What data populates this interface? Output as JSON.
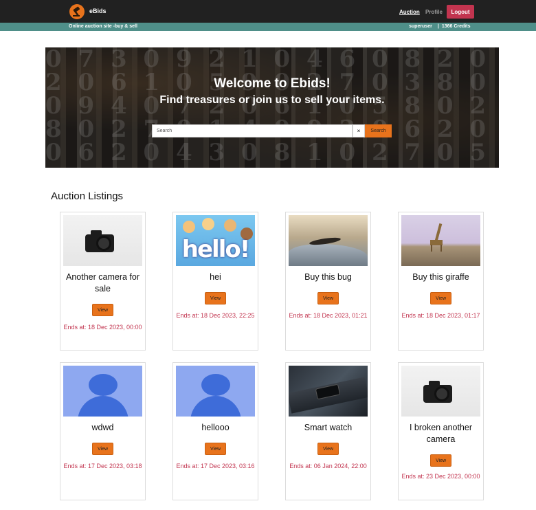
{
  "app": {
    "brand": "eBids",
    "tagline": "Online auction site -buy & sell"
  },
  "nav": {
    "auction": "Auction",
    "profile": "Profile",
    "logout": "Logout"
  },
  "user": {
    "username": "superuser",
    "credits": "1366 Credits"
  },
  "hero": {
    "title": "Welcome to Ebids!",
    "subtitle": "Find treasures or join us to sell your items.",
    "search_placeholder": "Search",
    "clear_label": "×",
    "search_button": "Search"
  },
  "listings": {
    "heading": "Auction Listings",
    "view_label": "View",
    "items": [
      {
        "title": "Another camera for sale",
        "ends": "Ends at: 18 Dec 2023, 00:00",
        "image": "camera"
      },
      {
        "title": "hei",
        "ends": "Ends at: 18 Dec 2023, 22:25",
        "image": "hello-kids"
      },
      {
        "title": "Buy this bug",
        "ends": "Ends at: 18 Dec 2023, 01:21",
        "image": "bug"
      },
      {
        "title": "Buy this giraffe",
        "ends": "Ends at: 18 Dec 2023, 01:17",
        "image": "giraffe"
      },
      {
        "title": "wdwd",
        "ends": "Ends at: 17 Dec 2023, 03:18",
        "image": "avatar-placeholder"
      },
      {
        "title": "hellooo",
        "ends": "Ends at: 17 Dec 2023, 03:16",
        "image": "avatar-placeholder"
      },
      {
        "title": "Smart watch",
        "ends": "Ends at: 06 Jan 2024, 22:00",
        "image": "smart-watch"
      },
      {
        "title": "I broken another camera",
        "ends": "Ends at: 23 Dec 2023, 00:00",
        "image": "camera"
      }
    ]
  },
  "colors": {
    "navbar": "#212121",
    "subbar": "#4f8f89",
    "accent": "#e8731c",
    "logout": "#c2344f",
    "ends_text": "#c2344f"
  }
}
